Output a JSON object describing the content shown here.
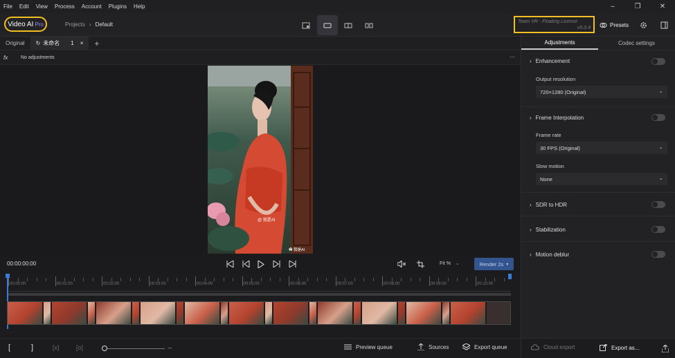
{
  "menu": [
    "File",
    "Edit",
    "View",
    "Process",
    "Account",
    "Plugins",
    "Help"
  ],
  "window_controls": {
    "minimize": "–",
    "maximize": "❐",
    "close": "✕"
  },
  "logo": {
    "name": "Video AI",
    "badge": "Pro"
  },
  "breadcrumb": {
    "root": "Projects",
    "separator": "›",
    "current": "Default"
  },
  "license": {
    "text": "Team VR - Floating License",
    "version": "v5.0.4"
  },
  "presets_label": "Presets",
  "tabs": {
    "original": "Original",
    "current": "未命名",
    "count": "1",
    "close": "×",
    "add": "+"
  },
  "adjustments_bar": {
    "fx": "fx",
    "text": "No adjustments",
    "more": "···"
  },
  "video": {
    "watermark_center": "@ 我是AI",
    "watermark_corner": "✿ 我是AI"
  },
  "playback": {
    "timecode": "00:00:00:00",
    "zoom": "Fit %",
    "render": "Render 2s"
  },
  "timeline_labels": [
    "00:00:00",
    "00:01:00",
    "00:02:00",
    "00:03:00",
    "00:04:00",
    "00:05:00",
    "00:06:00",
    "00:07:00",
    "00:08:00",
    "00:09:00",
    "00:10:00"
  ],
  "bottom": {
    "bracket_in": "[",
    "bracket_out": "]",
    "minus": "–",
    "preview_queue": "Preview queue",
    "sources": "Sources",
    "export_queue": "Export queue",
    "cloud_export": "Cloud export",
    "export_as": "Export as..."
  },
  "right_tabs": [
    "Adjustments",
    "Codec settings"
  ],
  "sections": {
    "enhancement": {
      "title": "Enhancement",
      "output_label": "Output resolution",
      "output_value": "720×1280 (Original)"
    },
    "interpolation": {
      "title": "Frame Interpolation",
      "rate_label": "Frame rate",
      "rate_value": "30 FPS (Original)",
      "slow_label": "Slow motion",
      "slow_value": "None"
    },
    "sdr_hdr": {
      "title": "SDR to HDR"
    },
    "stabilization": {
      "title": "Stabilization"
    },
    "motion_deblur": {
      "title": "Motion deblur"
    }
  },
  "colors": {
    "highlight": "#f3c023",
    "accent": "#9b8cff",
    "render_btn": "#34548f",
    "playhead": "#3a7bd5"
  }
}
